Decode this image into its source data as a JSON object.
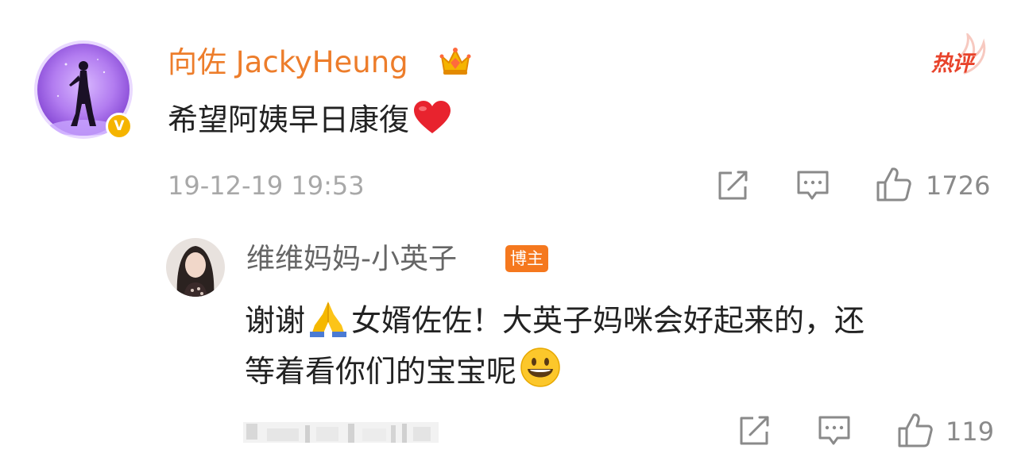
{
  "comment": {
    "author": "向佐 JackyHeung",
    "author_badge": "crown-icon",
    "verified_badge": "V",
    "hot_label": "热评",
    "text": "希望阿姨早日康復",
    "text_emoji": "heart-icon",
    "timestamp": "19-12-19 19:53",
    "actions": {
      "share": "share-icon",
      "reply": "comment-icon",
      "like": "like-icon",
      "like_count": "1726"
    }
  },
  "reply": {
    "author": "维维妈妈-小英子",
    "badge_label": "博主",
    "text_line1_a": "谢谢",
    "text_line1_emoji": "folded-hands-emoji",
    "text_line1_b": "女婿佐佐！大英子妈咪会好起来的，还",
    "text_line2": "等着看你们的宝宝呢",
    "text_line2_emoji": "grinning-face-emoji",
    "actions": {
      "share": "share-icon",
      "reply": "comment-icon",
      "like": "like-icon",
      "like_count": "119"
    }
  },
  "colors": {
    "name_orange": "#ed7d2b",
    "hot_red": "#e8432b",
    "badge_orange": "#f5781e",
    "verified_yellow": "#f5b400",
    "text_dark": "#222222",
    "muted": "#a8a8a8"
  }
}
